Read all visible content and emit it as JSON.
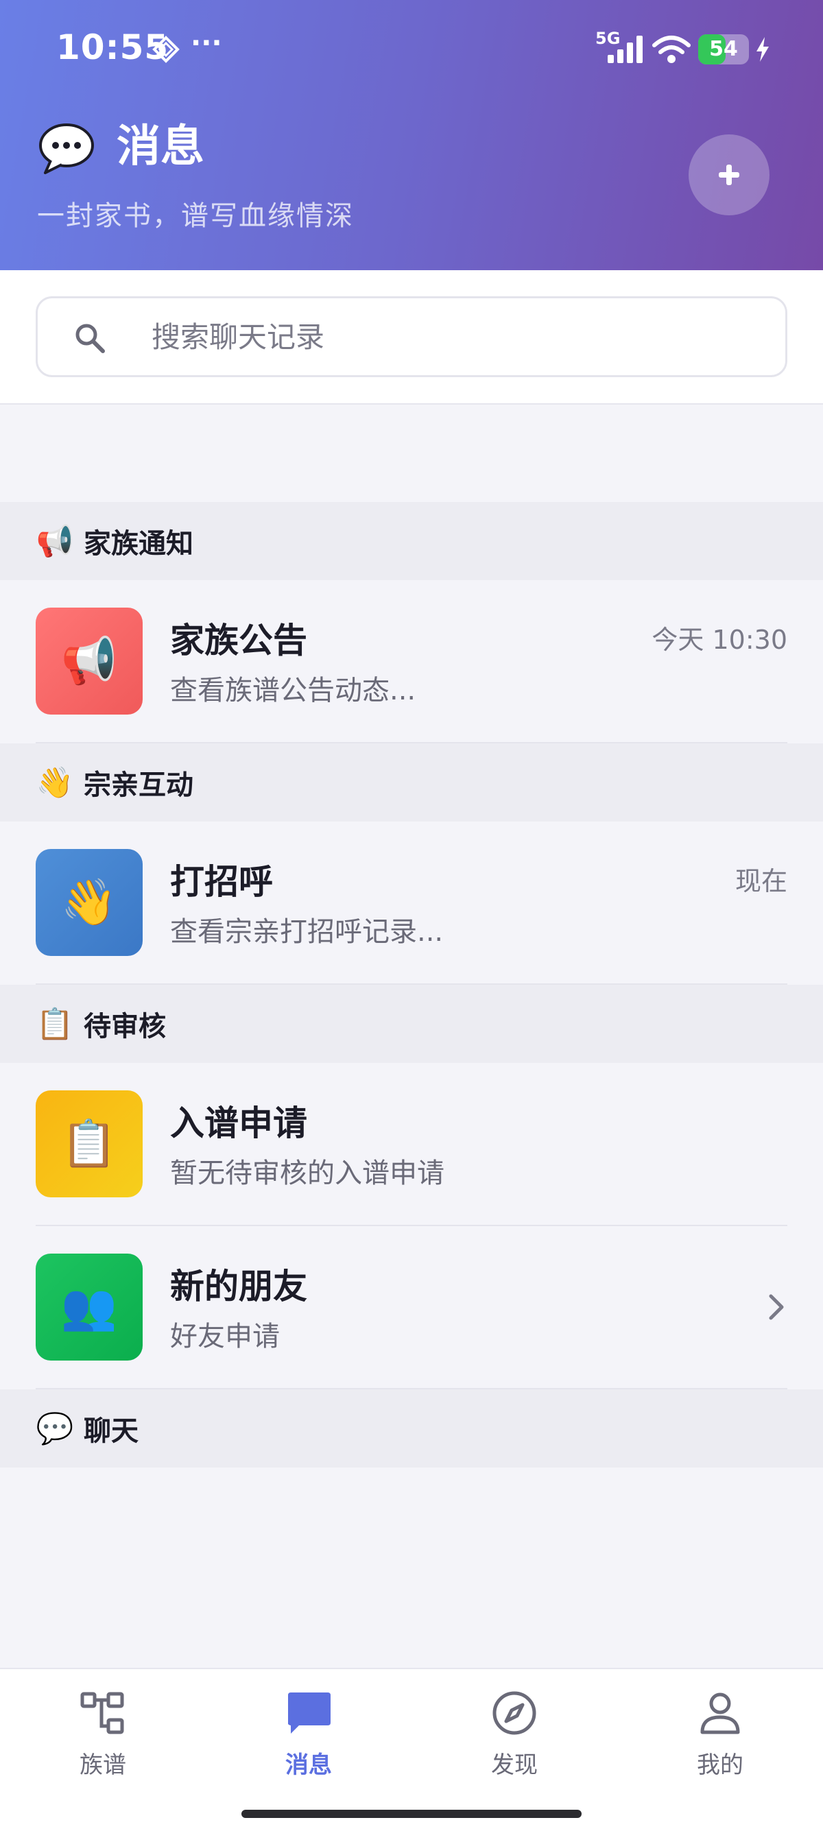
{
  "status_bar": {
    "time": "10:55",
    "dots": "···",
    "network": "5G",
    "battery": "54",
    "battery_level": 0.54
  },
  "header": {
    "title": "消息",
    "subtitle": "一封家书，谱写血缘情深",
    "gradient_start": "#6a7fe6",
    "gradient_end": "#764aa8"
  },
  "search": {
    "placeholder": "搜索聊天记录",
    "value": ""
  },
  "sections": {
    "notice": {
      "emoji": "📢",
      "title": "家族通知"
    },
    "interact": {
      "emoji": "👋",
      "title": "宗亲互动"
    },
    "pending": {
      "emoji": "📋",
      "title": "待审核"
    },
    "chat": {
      "emoji": "💬",
      "title": "聊天"
    }
  },
  "items": {
    "announcement": {
      "emoji": "📢",
      "title": "家族公告",
      "subtitle": "查看族谱公告动态...",
      "time": "今天 10:30"
    },
    "greeting": {
      "emoji": "👋",
      "title": "打招呼",
      "subtitle": "查看宗亲打招呼记录...",
      "time": "现在"
    },
    "application": {
      "emoji": "📋",
      "title": "入谱申请",
      "subtitle": "暂无待审核的入谱申请"
    },
    "friends": {
      "emoji": "👥",
      "title": "新的朋友",
      "subtitle": "好友申请"
    }
  },
  "tabs": [
    {
      "label": "族谱",
      "icon": "family-tree-icon",
      "active": false
    },
    {
      "label": "消息",
      "icon": "chat-bubble-icon",
      "active": true
    },
    {
      "label": "发现",
      "icon": "compass-icon",
      "active": false
    },
    {
      "label": "我的",
      "icon": "person-icon",
      "active": false
    }
  ],
  "colors": {
    "accent": "#5b6fe0",
    "announcement_icon": "#f05a5a",
    "greeting_icon": "#3b78c6",
    "application_icon": "#f9b512",
    "friends_icon": "#0bae4d"
  }
}
